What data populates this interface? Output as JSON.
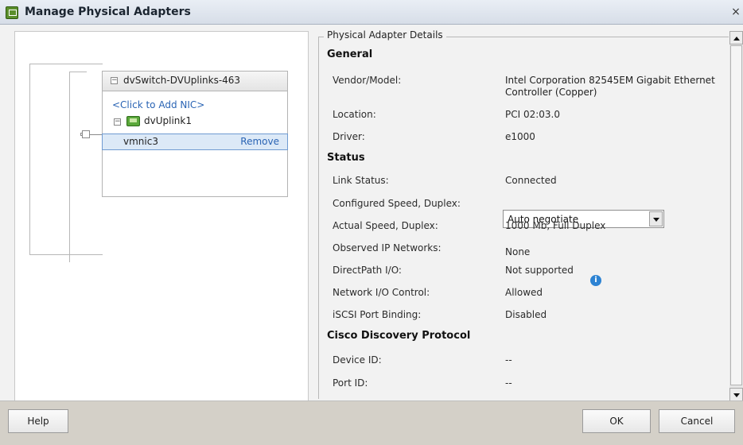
{
  "window": {
    "title": "Manage Physical Adapters",
    "close_symbol": "×"
  },
  "tree": {
    "switch_name": "dvSwitch-DVUplinks-463",
    "add_nic": "<Click to Add NIC>",
    "uplink_name": "dvUplink1",
    "nic_name": "vmnic3",
    "remove_label": "Remove"
  },
  "details": {
    "group_title": "Physical Adapter Details",
    "general": {
      "heading": "General",
      "vendor_label": "Vendor/Model:",
      "vendor_value": "Intel Corporation 82545EM Gigabit Ethernet Controller (Copper)",
      "location_label": "Location:",
      "location_value": "PCI 02:03.0",
      "driver_label": "Driver:",
      "driver_value": "e1000"
    },
    "status": {
      "heading": "Status",
      "link_status_label": "Link Status:",
      "link_status_value": "Connected",
      "configured_speed_label": "Configured Speed, Duplex:",
      "configured_speed_value": "Auto negotiate",
      "actual_speed_label": "Actual Speed, Duplex:",
      "actual_speed_value": "1000 Mb, Full Duplex",
      "observed_ip_label": "Observed IP Networks:",
      "observed_ip_value": "None",
      "directpath_label": "DirectPath I/O:",
      "directpath_value": "Not supported",
      "network_io_label": "Network I/O Control:",
      "network_io_value": "Allowed",
      "iscsi_label": "iSCSI Port Binding:",
      "iscsi_value": "Disabled"
    },
    "cdp": {
      "heading": "Cisco Discovery Protocol",
      "device_id_label": "Device ID:",
      "device_id_value": "--",
      "port_id_label": "Port ID:",
      "port_id_value": "--"
    }
  },
  "footer": {
    "help": "Help",
    "ok": "OK",
    "cancel": "Cancel"
  },
  "icons": {
    "app": "vsphere-icon",
    "uplink": "uplink-icon",
    "info": "info-icon",
    "collapse": "collapse-icon"
  },
  "colors": {
    "link": "#2a64b4",
    "selection": "#dce9f7",
    "info": "#2d83d3"
  }
}
